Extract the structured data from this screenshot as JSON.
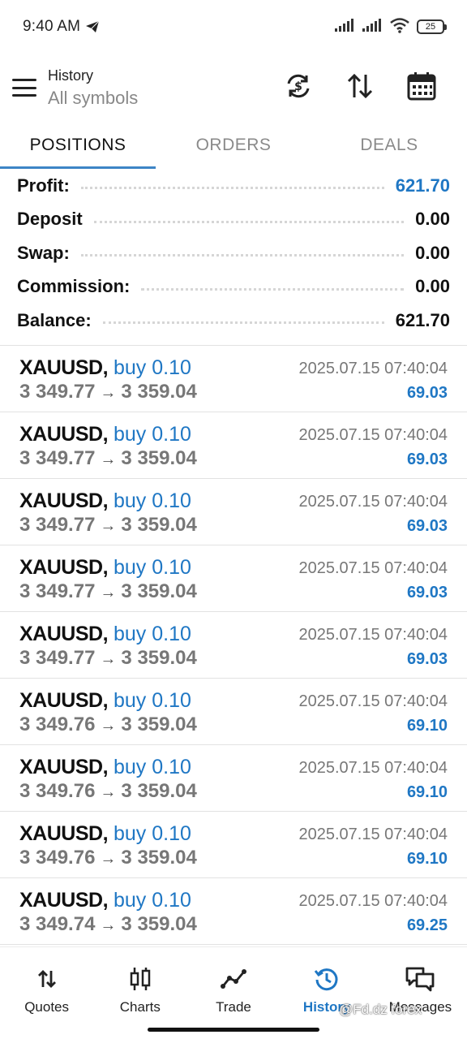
{
  "status_bar": {
    "time": "9:40 AM",
    "battery": "25"
  },
  "header": {
    "title": "History",
    "subtitle": "All symbols"
  },
  "tabs": [
    {
      "label": "POSITIONS",
      "active": true
    },
    {
      "label": "ORDERS",
      "active": false
    },
    {
      "label": "DEALS",
      "active": false
    }
  ],
  "summary": [
    {
      "label": "Profit:",
      "value": "621.70",
      "highlight": true
    },
    {
      "label": "Deposit",
      "value": "0.00",
      "highlight": false
    },
    {
      "label": "Swap:",
      "value": "0.00",
      "highlight": false
    },
    {
      "label": "Commission:",
      "value": "0.00",
      "highlight": false
    },
    {
      "label": "Balance:",
      "value": "621.70",
      "highlight": false
    }
  ],
  "deals": [
    {
      "symbol": "XAUUSD,",
      "type": "buy 0.10",
      "open_price": "3 349.77",
      "close_price": "3 359.04",
      "time": "2025.07.15 07:40:04",
      "profit": "69.03"
    },
    {
      "symbol": "XAUUSD,",
      "type": "buy 0.10",
      "open_price": "3 349.77",
      "close_price": "3 359.04",
      "time": "2025.07.15 07:40:04",
      "profit": "69.03"
    },
    {
      "symbol": "XAUUSD,",
      "type": "buy 0.10",
      "open_price": "3 349.77",
      "close_price": "3 359.04",
      "time": "2025.07.15 07:40:04",
      "profit": "69.03"
    },
    {
      "symbol": "XAUUSD,",
      "type": "buy 0.10",
      "open_price": "3 349.77",
      "close_price": "3 359.04",
      "time": "2025.07.15 07:40:04",
      "profit": "69.03"
    },
    {
      "symbol": "XAUUSD,",
      "type": "buy 0.10",
      "open_price": "3 349.77",
      "close_price": "3 359.04",
      "time": "2025.07.15 07:40:04",
      "profit": "69.03"
    },
    {
      "symbol": "XAUUSD,",
      "type": "buy 0.10",
      "open_price": "3 349.76",
      "close_price": "3 359.04",
      "time": "2025.07.15 07:40:04",
      "profit": "69.10"
    },
    {
      "symbol": "XAUUSD,",
      "type": "buy 0.10",
      "open_price": "3 349.76",
      "close_price": "3 359.04",
      "time": "2025.07.15 07:40:04",
      "profit": "69.10"
    },
    {
      "symbol": "XAUUSD,",
      "type": "buy 0.10",
      "open_price": "3 349.76",
      "close_price": "3 359.04",
      "time": "2025.07.15 07:40:04",
      "profit": "69.10"
    },
    {
      "symbol": "XAUUSD,",
      "type": "buy 0.10",
      "open_price": "3 349.74",
      "close_price": "3 359.04",
      "time": "2025.07.15 07:40:04",
      "profit": "69.25"
    }
  ],
  "bottom_nav": [
    {
      "label": "Quotes",
      "icon": "quotes-icon",
      "active": false
    },
    {
      "label": "Charts",
      "icon": "charts-icon",
      "active": false
    },
    {
      "label": "Trade",
      "icon": "trade-icon",
      "active": false
    },
    {
      "label": "History",
      "icon": "history-icon",
      "active": true
    },
    {
      "label": "Messages",
      "icon": "messages-icon",
      "active": false
    }
  ],
  "watermark": "@Fd.dz forex",
  "colors": {
    "accent": "#1f77c4",
    "tab_underline": "#3d85c6",
    "muted_text": "#777777"
  }
}
